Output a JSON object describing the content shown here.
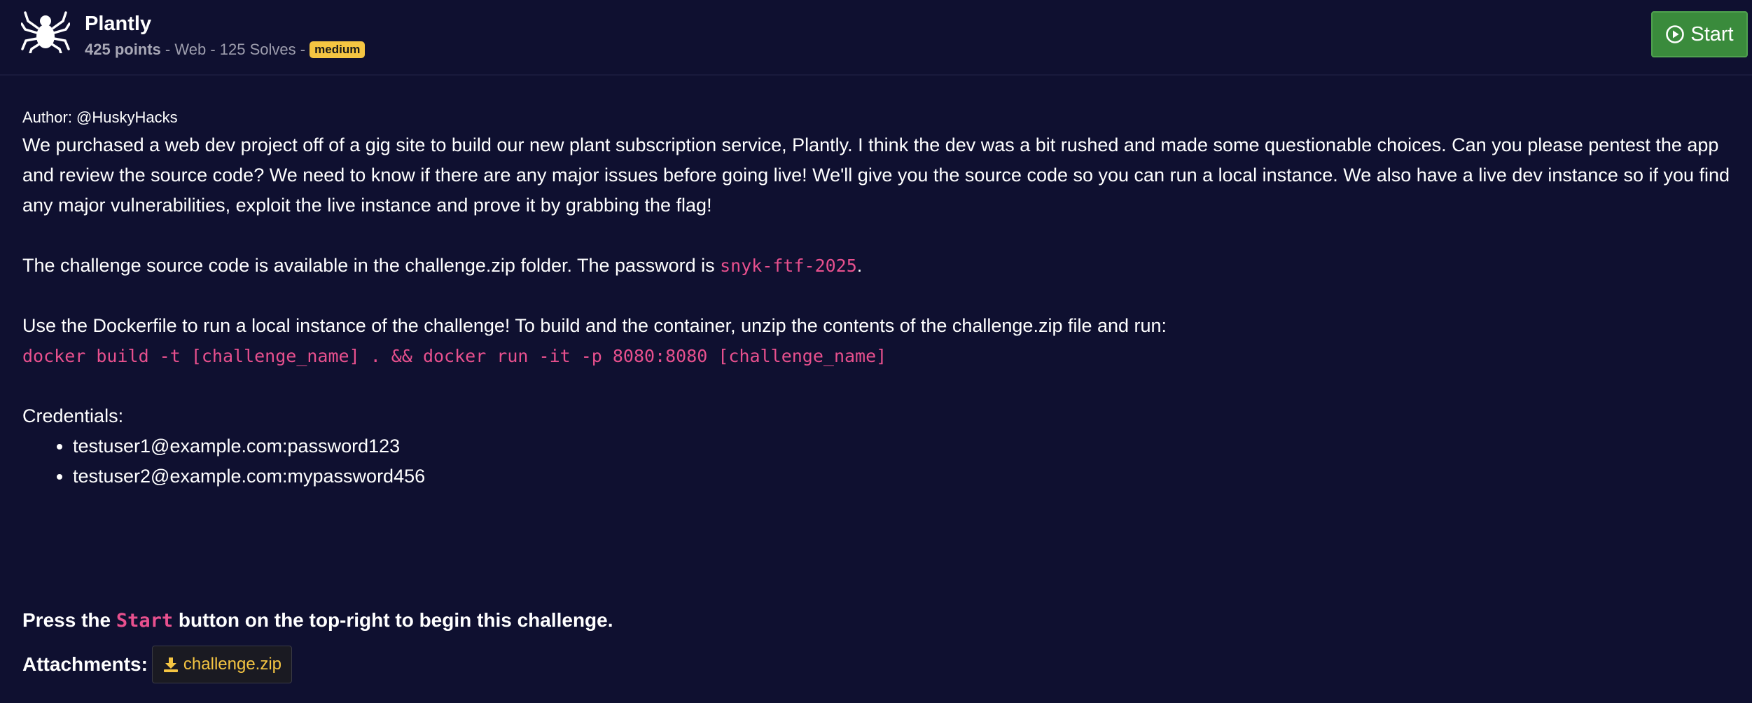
{
  "challenge": {
    "title": "Plantly",
    "points": "425 points",
    "meta_rest": " - Web - 125 Solves - ",
    "difficulty": "medium",
    "start_label": "Start"
  },
  "description": {
    "author": "Author: @HuskyHacks",
    "intro": "We purchased a web dev project off of a gig site to build our new plant subscription service, Plantly. I think the dev was a bit rushed and made some questionable choices. Can you please pentest the app and review the source code? We need to know if there are any major issues before going live! We'll give you the source code so you can run a local instance. We also have a live dev instance so if you find any major vulnerabilities, exploit the live instance and prove it by grabbing the flag!",
    "source_prefix": "The challenge source code is available in the challenge.zip folder. The password is ",
    "password": "snyk-ftf-2025",
    "source_suffix": ".",
    "docker_intro": "Use the Dockerfile to run a local instance of the challenge! To build and the container, unzip the contents of the challenge.zip file and run:",
    "docker_command": "docker build -t [challenge_name] . && docker run -it -p 8080:8080 [challenge_name]",
    "credentials_label": "Credentials:",
    "credentials": [
      "testuser1@example.com:password123",
      "testuser2@example.com:mypassword456"
    ]
  },
  "footer": {
    "press_prefix": "Press the ",
    "press_code": "Start",
    "press_suffix": " button on the top-right to begin this challenge.",
    "attachments_label": "Attachments:",
    "attachment_file": "challenge.zip"
  },
  "colors": {
    "background": "#0f1030",
    "code_pink": "#e8508e",
    "badge_yellow": "#f5c542",
    "start_green": "#3a8b3c"
  },
  "icons": {
    "logo": "spider-icon",
    "start": "play-circle-icon",
    "attachment": "download-icon"
  }
}
